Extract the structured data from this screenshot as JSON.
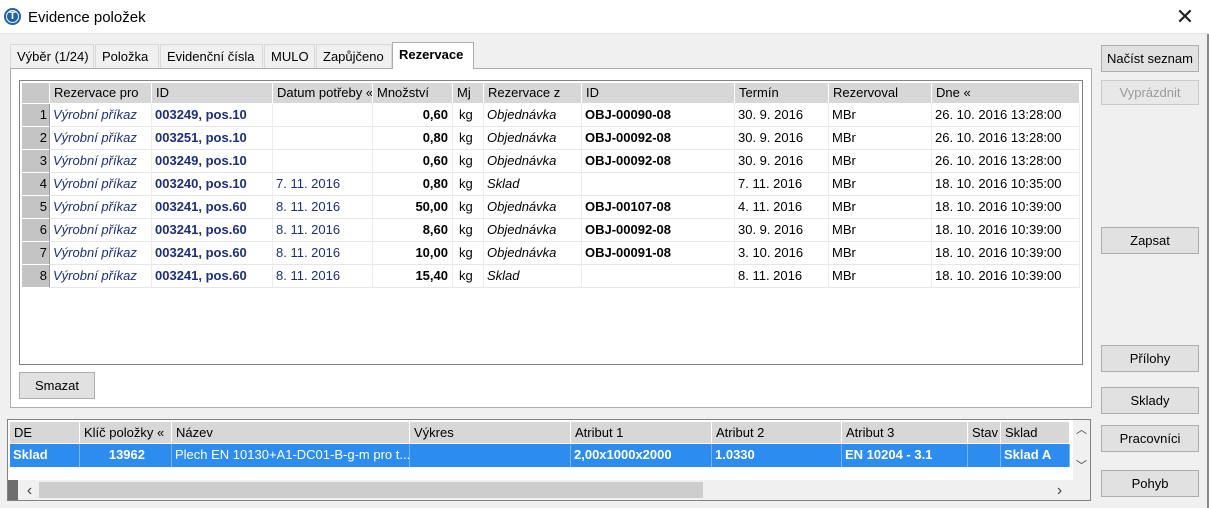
{
  "window": {
    "title": "Evidence položek",
    "icon_letter": "T",
    "close_symbol": "✕"
  },
  "tabs": [
    "Výběr (1/24)",
    "Položka",
    "Evidenční čísla",
    "MULO",
    "Zapůjčeno",
    "Rezervace"
  ],
  "active_tab": "Rezervace",
  "reservations": {
    "columns": [
      "Rezervace pro",
      "ID",
      "Datum potřeby «",
      "Množství",
      "Mj",
      "Rezervace z",
      "ID",
      "Termín",
      "Rezervoval",
      "Dne «"
    ],
    "rows": [
      {
        "n": "1",
        "pro": "Výrobní příkaz",
        "id": "003249, pos.10",
        "datum": "",
        "mnozstvi": "0,60",
        "mj": "kg",
        "z": "Objednávka",
        "id2": "OBJ-00090-08",
        "termin": "30. 9. 2016",
        "rezervoval": "MBr",
        "dne": "26. 10. 2016 13:28:00"
      },
      {
        "n": "2",
        "pro": "Výrobní příkaz",
        "id": "003251, pos.10",
        "datum": "",
        "mnozstvi": "0,80",
        "mj": "kg",
        "z": "Objednávka",
        "id2": "OBJ-00092-08",
        "termin": "30. 9. 2016",
        "rezervoval": "MBr",
        "dne": "26. 10. 2016 13:28:00"
      },
      {
        "n": "3",
        "pro": "Výrobní příkaz",
        "id": "003249, pos.10",
        "datum": "",
        "mnozstvi": "0,60",
        "mj": "kg",
        "z": "Objednávka",
        "id2": "OBJ-00092-08",
        "termin": "30. 9. 2016",
        "rezervoval": "MBr",
        "dne": "26. 10. 2016 13:28:00"
      },
      {
        "n": "4",
        "pro": "Výrobní příkaz",
        "id": "003240, pos.10",
        "datum": "7. 11. 2016",
        "mnozstvi": "0,80",
        "mj": "kg",
        "z": "Sklad",
        "id2": "",
        "termin": "7. 11. 2016",
        "rezervoval": "MBr",
        "dne": "18. 10. 2016 10:35:00"
      },
      {
        "n": "5",
        "pro": "Výrobní příkaz",
        "id": "003241, pos.60",
        "datum": "8. 11. 2016",
        "mnozstvi": "50,00",
        "mj": "kg",
        "z": "Objednávka",
        "id2": "OBJ-00107-08",
        "termin": "4. 11. 2016",
        "rezervoval": "MBr",
        "dne": "18. 10. 2016 10:39:00"
      },
      {
        "n": "6",
        "pro": "Výrobní příkaz",
        "id": "003241, pos.60",
        "datum": "8. 11. 2016",
        "mnozstvi": "8,60",
        "mj": "kg",
        "z": "Objednávka",
        "id2": "OBJ-00092-08",
        "termin": "30. 9. 2016",
        "rezervoval": "MBr",
        "dne": "18. 10. 2016 10:39:00"
      },
      {
        "n": "7",
        "pro": "Výrobní příkaz",
        "id": "003241, pos.60",
        "datum": "8. 11. 2016",
        "mnozstvi": "10,00",
        "mj": "kg",
        "z": "Objednávka",
        "id2": "OBJ-00091-08",
        "termin": "3. 10. 2016",
        "rezervoval": "MBr",
        "dne": "18. 10. 2016 10:39:00"
      },
      {
        "n": "8",
        "pro": "Výrobní příkaz",
        "id": "003241, pos.60",
        "datum": "8. 11. 2016",
        "mnozstvi": "15,40",
        "mj": "kg",
        "z": "Sklad",
        "id2": "",
        "termin": "8. 11. 2016",
        "rezervoval": "MBr",
        "dne": "18. 10. 2016 10:39:00"
      }
    ],
    "delete_button": "Smazat"
  },
  "side_buttons": {
    "load": "Načíst seznam",
    "clear": "Vyprázdnit",
    "save": "Zapsat",
    "attachments": "Přílohy",
    "warehouses": "Sklady",
    "workplaces": "Pracovníci",
    "movement": "Pohyb"
  },
  "items": {
    "columns": [
      "DE",
      "Klíč položky «",
      "Název",
      "Výkres",
      "Atribut 1",
      "Atribut 2",
      "Atribut 3",
      "Stav",
      "Sklad"
    ],
    "selected_row": {
      "de": "Sklad",
      "klic": "13962",
      "nazev": "Plech EN 10130+A1-DC01-B-g-m pro t...",
      "vykres": "",
      "atribut1": "2,00x1000x2000",
      "atribut2": "1.0330",
      "atribut3": "EN 10204 - 3.1",
      "stav": "",
      "sklad": "Sklad A"
    }
  },
  "scroll_arrows": {
    "up": "︿",
    "down": "﹀",
    "left": "‹",
    "right": "›"
  },
  "colors": {
    "selection": "#2d8cf0",
    "link_text": "#1c2e7c",
    "header": "#d7d7d7"
  }
}
